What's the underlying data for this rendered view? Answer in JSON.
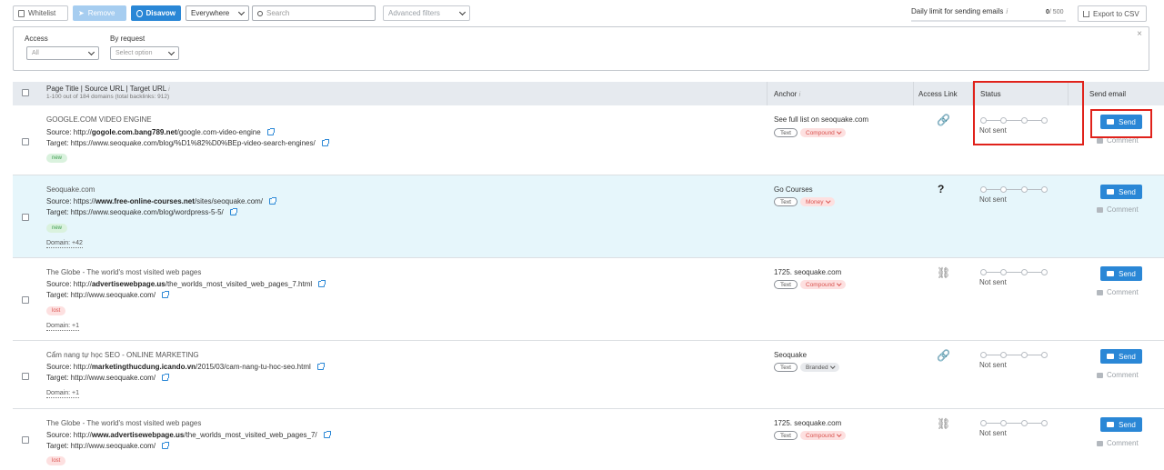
{
  "toolbar": {
    "whitelist": "Whitelist",
    "remove": "Remove",
    "disavow": "Disavow",
    "scope_select": "Everywhere",
    "search_placeholder": "Search",
    "advanced_filters": "Advanced filters",
    "daily_limit_label": "Daily limit for sending emails",
    "daily_limit_info": "i",
    "daily_limit_used": "0",
    "daily_limit_max": "/ 500",
    "export": "Export to CSV"
  },
  "filters": {
    "access_label": "Access",
    "access_value": "All",
    "by_request_label": "By request",
    "by_request_placeholder": "Select option",
    "close": "×"
  },
  "table": {
    "headers": {
      "page": "Page Title | Source URL | Target URL",
      "page_info": "i",
      "page_sub": "1-100 out of 184 domains (total backlinks: 912)",
      "anchor": "Anchor",
      "anchor_info": "i",
      "access_link": "Access Link",
      "status": "Status",
      "send_email": "Send email"
    },
    "rows": [
      {
        "title": "GOOGLE.COM VIDEO ENGINE",
        "source_prefix": "Source: http://",
        "source_bold": "gogole.com.bang789.net",
        "source_rest": "/google.com-video-engine",
        "target": "Target: https://www.seoquake.com/blog/%D1%82%D0%BEp-video-search-engines/",
        "tag": "new",
        "domain": "",
        "anchor": "See full list on seoquake.com",
        "anchor_kind": "Text",
        "anchor_type": "Compound",
        "access": "🔗",
        "status": "Not sent",
        "send": "Send",
        "comment": "Comment"
      },
      {
        "title": "Seoquake.com",
        "source_prefix": "Source: https://",
        "source_bold": "www.free-online-courses.net",
        "source_rest": "/sites/seoquake.com/",
        "target": "Target: https://www.seoquake.com/blog/wordpress-5-5/",
        "tag": "new",
        "domain": "Domain: +42",
        "anchor": "Go Courses",
        "anchor_kind": "Text",
        "anchor_type": "Money",
        "access": "?",
        "status": "Not sent",
        "send": "Send",
        "comment": "Comment"
      },
      {
        "title": "The Globe - The world's most visited web pages",
        "source_prefix": "Source: http://",
        "source_bold": "advertisewebpage.us",
        "source_rest": "/the_worlds_most_visited_web_pages_7.html",
        "target": "Target: http://www.seoquake.com/",
        "tag": "lost",
        "domain": "Domain: +1",
        "anchor": "1725. seoquake.com",
        "anchor_kind": "Text",
        "anchor_type": "Compound",
        "access": "⛓",
        "status": "Not sent",
        "send": "Send",
        "comment": "Comment"
      },
      {
        "title": "Cẩm nang tự học SEO - ONLINE MARKETING",
        "source_prefix": "Source: http://",
        "source_bold": "marketingthucdung.icando.vn",
        "source_rest": "/2015/03/cam-nang-tu-hoc-seo.html",
        "target": "Target: http://www.seoquake.com/",
        "tag": "",
        "domain": "Domain: +1",
        "anchor": "Seoquake",
        "anchor_kind": "Text",
        "anchor_type": "Branded",
        "access": "🔗",
        "status": "Not sent",
        "send": "Send",
        "comment": "Comment"
      },
      {
        "title": "The Globe - The world's most visited web pages",
        "source_prefix": "Source: http://",
        "source_bold": "www.advertisewebpage.us",
        "source_rest": "/the_worlds_most_visited_web_pages_7/",
        "target": "Target: http://www.seoquake.com/",
        "tag": "lost",
        "domain": "",
        "anchor": "1725. seoquake.com",
        "anchor_kind": "Text",
        "anchor_type": "Compound",
        "access": "⛓",
        "status": "Not sent",
        "send": "Send",
        "comment": "Comment"
      }
    ]
  },
  "colors": {
    "primary": "#2a87d6",
    "highlight_row": "#e6f6fb",
    "annotation_red": "#e0221b",
    "tag_new": "#daf2de",
    "tag_lost": "#fde0e0"
  }
}
